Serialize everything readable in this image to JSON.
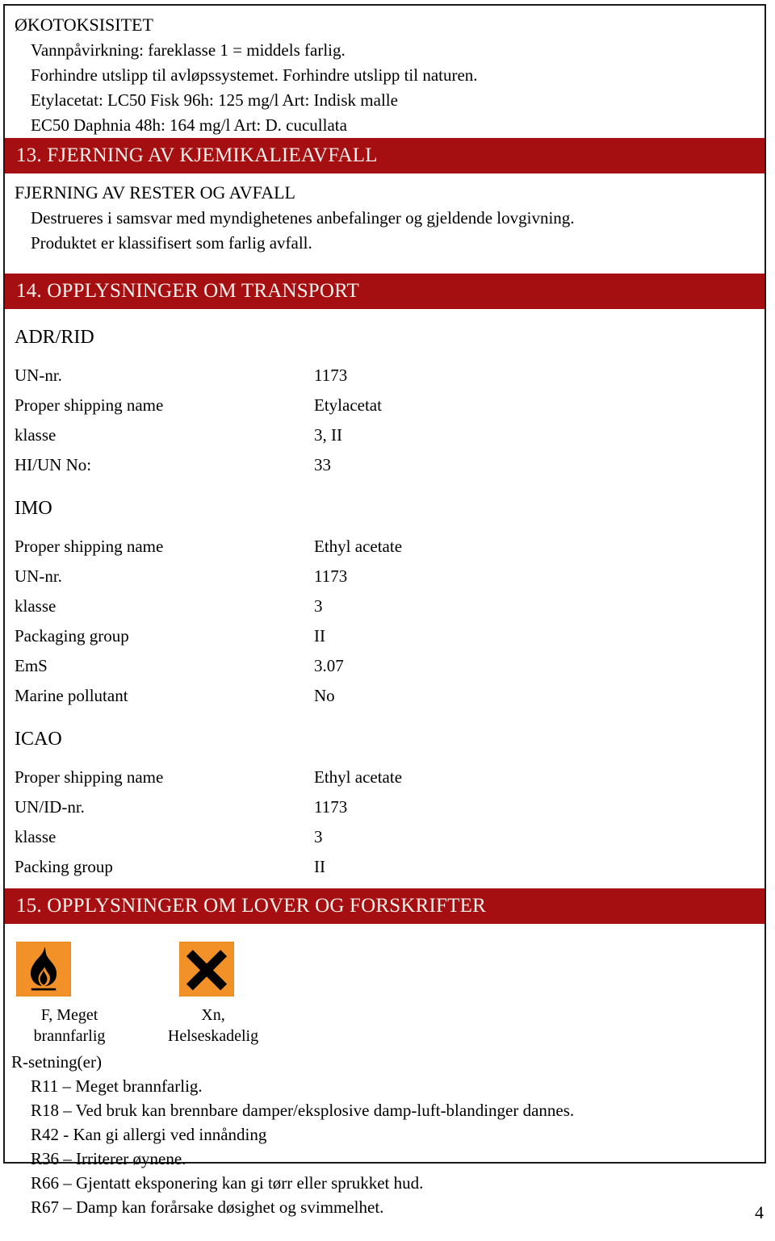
{
  "document": {
    "page_number": "4",
    "accent_red": "#A60F12",
    "pictogram_orange": "#F29127"
  },
  "ecotoxicity": {
    "heading": "ØKOTOKSISITET",
    "lines": [
      "Vannpåvirkning: fareklasse 1 = middels farlig.",
      "Forhindre utslipp til avløpssystemet. Forhindre utslipp til naturen.",
      "Etylacetat: LC50 Fisk 96h: 125 mg/l Art: Indisk malle",
      "EC50 Daphnia 48h: 164 mg/l Art: D. cucullata"
    ]
  },
  "section13": {
    "banner": "13. FJERNING AV KJEMIKALIEAVFALL",
    "subheading": "FJERNING AV RESTER OG AVFALL",
    "lines": [
      "Destrueres i samsvar med myndighetenes anbefalinger og gjeldende lovgivning.",
      "Produktet er klassifisert som farlig avfall."
    ]
  },
  "section14": {
    "banner": "14. OPPLYSNINGER OM TRANSPORT",
    "groups": [
      {
        "title": "ADR/RID",
        "rows": [
          {
            "label": "UN-nr.",
            "value": "1173"
          },
          {
            "label": "Proper shipping name",
            "value": "Etylacetat"
          },
          {
            "label": "klasse",
            "value": "3, II"
          },
          {
            "label": "HI/UN No:",
            "value": "33"
          }
        ]
      },
      {
        "title": "IMO",
        "rows": [
          {
            "label": "Proper shipping name",
            "value": "Ethyl acetate"
          },
          {
            "label": "UN-nr.",
            "value": "1173"
          },
          {
            "label": "klasse",
            "value": "3"
          },
          {
            "label": "Packaging group",
            "value": "II"
          },
          {
            "label": "EmS",
            "value": "3.07"
          },
          {
            "label": "Marine pollutant",
            "value": "No"
          }
        ]
      },
      {
        "title": "ICAO",
        "rows": [
          {
            "label": "Proper shipping name",
            "value": "Ethyl acetate"
          },
          {
            "label": "UN/ID-nr.",
            "value": "1173"
          },
          {
            "label": "klasse",
            "value": "3"
          },
          {
            "label": "Packing group",
            "value": "II"
          }
        ]
      }
    ]
  },
  "section15": {
    "banner": "15. OPPLYSNINGER OM LOVER OG FORSKRIFTER",
    "pictograms": [
      {
        "icon": "flame-icon",
        "caption_line1": "F, Meget",
        "caption_line2": "brannfarlig"
      },
      {
        "icon": "x-cross-icon",
        "caption_line1": "Xn,",
        "caption_line2": "Helseskadelig"
      }
    ],
    "r_phrases_heading": "R-setning(er)",
    "r_phrases": [
      "R11 – Meget brannfarlig.",
      "R18 – Ved bruk kan brennbare damper/eksplosive damp-luft-blandinger dannes.",
      "R42 - Kan gi allergi ved innånding",
      "R36 – Irriterer øynene.",
      "R66 – Gjentatt eksponering kan gi tørr eller sprukket hud.",
      "R67 – Damp kan forårsake døsighet og svimmelhet."
    ]
  }
}
